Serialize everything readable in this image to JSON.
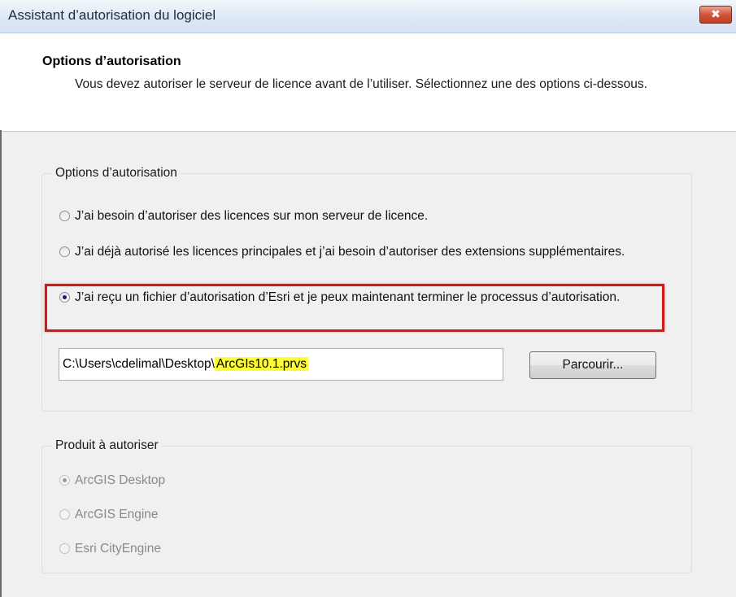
{
  "window": {
    "title": "Assistant d’autorisation du logiciel",
    "close_glyph": "✖"
  },
  "header": {
    "title": "Options d’autorisation",
    "description": "Vous devez autoriser le serveur de licence avant de l’utiliser. Sélectionnez une des options ci-dessous."
  },
  "auth_options": {
    "legend": "Options d’autorisation",
    "options": [
      {
        "label": "J’ai besoin d’autoriser des licences sur mon serveur de licence.",
        "checked": false
      },
      {
        "label": "J’ai déjà autorisé les licences principales et j’ai besoin d’autoriser des extensions supplémentaires.",
        "checked": false
      },
      {
        "label": "J’ai reçu un fichier d’autorisation d’Esri et je peux maintenant terminer le processus d’autorisation.",
        "checked": true
      }
    ],
    "file_path_prefix": "C:\\Users\\cdelimal\\Desktop\\",
    "file_name": "ArcGIs10.1.prvs",
    "browse_label": "Parcourir..."
  },
  "product": {
    "legend": "Produit à autoriser",
    "options": [
      {
        "label": "ArcGIS Desktop",
        "checked": true
      },
      {
        "label": "ArcGIS Engine",
        "checked": false
      },
      {
        "label": "Esri CityEngine",
        "checked": false
      }
    ]
  },
  "colors": {
    "highlight_border": "#d11a1a",
    "filename_highlight": "#ffff33"
  }
}
